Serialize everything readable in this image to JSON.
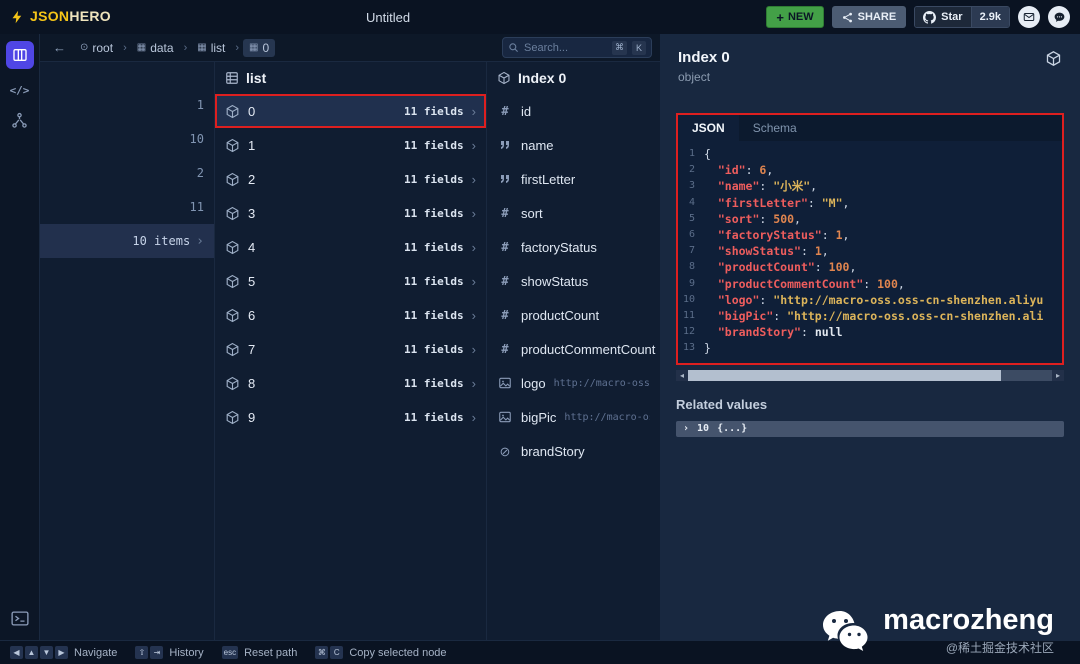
{
  "ui": {
    "chevron": "›",
    "glyphs": {
      "hash": "#",
      "null": "⊘",
      "grid": "▦",
      "root": "⊙",
      "back": "←",
      "code": "</>",
      "plus": "+"
    },
    "scrollbar_arrows": [
      "◂",
      "▸"
    ]
  },
  "topbar": {
    "logo_json": "JSON",
    "logo_hero": "HERO",
    "title": "Untitled",
    "new_button": "NEW",
    "share_button": "SHARE",
    "star_button": "Star",
    "star_count": "2.9k"
  },
  "breadcrumb": {
    "separator": "›",
    "items": [
      {
        "icon": "root-icon",
        "label": "root"
      },
      {
        "icon": "grid-icon",
        "label": "data"
      },
      {
        "icon": "grid-icon",
        "label": "list"
      },
      {
        "icon": "grid-icon",
        "label": "0",
        "selected": true
      }
    ]
  },
  "search": {
    "placeholder": "Search...",
    "shortcut_keys": [
      "⌘",
      "K"
    ]
  },
  "columns": {
    "parent": {
      "rows": [
        {
          "value": "1"
        },
        {
          "value": "10"
        },
        {
          "value": "2"
        },
        {
          "value": "11"
        },
        {
          "value": "10 items",
          "selected": true
        }
      ]
    },
    "list": {
      "title": "list",
      "rows": [
        {
          "label": "0",
          "badge": "11 fields",
          "selected": true
        },
        {
          "label": "1",
          "badge": "11 fields"
        },
        {
          "label": "2",
          "badge": "11 fields"
        },
        {
          "label": "3",
          "badge": "11 fields"
        },
        {
          "label": "4",
          "badge": "11 fields"
        },
        {
          "label": "5",
          "badge": "11 fields"
        },
        {
          "label": "6",
          "badge": "11 fields"
        },
        {
          "label": "7",
          "badge": "11 fields"
        },
        {
          "label": "8",
          "badge": "11 fields"
        },
        {
          "label": "9",
          "badge": "11 fields"
        }
      ]
    },
    "detail": {
      "title": "Index 0",
      "rows": [
        {
          "icon": "hash-icon",
          "label": "id"
        },
        {
          "icon": "quotes-icon",
          "label": "name"
        },
        {
          "icon": "quotes-icon",
          "label": "firstLetter"
        },
        {
          "icon": "hash-icon",
          "label": "sort"
        },
        {
          "icon": "hash-icon",
          "label": "factoryStatus"
        },
        {
          "icon": "hash-icon",
          "label": "showStatus"
        },
        {
          "icon": "hash-icon",
          "label": "productCount"
        },
        {
          "icon": "hash-icon",
          "label": "productCommentCount"
        },
        {
          "icon": "image-icon",
          "label": "logo",
          "preview": "http://macro-oss.o"
        },
        {
          "icon": "image-icon",
          "label": "bigPic",
          "preview": "http://macro-oss.os"
        },
        {
          "icon": "null-icon",
          "label": "brandStory"
        }
      ]
    }
  },
  "inspector": {
    "title": "Index 0",
    "subtitle": "object",
    "tabs": [
      {
        "label": "JSON",
        "active": true
      },
      {
        "label": "Schema",
        "active": false
      }
    ],
    "code_lines": [
      {
        "n": "1",
        "t": [
          [
            "p",
            "{"
          ]
        ]
      },
      {
        "n": "2",
        "t": [
          [
            "p",
            "  "
          ],
          [
            "k",
            "\"id\""
          ],
          [
            "p",
            ": "
          ],
          [
            "n",
            "6"
          ],
          [
            "p",
            ","
          ]
        ]
      },
      {
        "n": "3",
        "t": [
          [
            "p",
            "  "
          ],
          [
            "k",
            "\"name\""
          ],
          [
            "p",
            ": "
          ],
          [
            "s",
            "\"小米\""
          ],
          [
            "p",
            ","
          ]
        ]
      },
      {
        "n": "4",
        "t": [
          [
            "p",
            "  "
          ],
          [
            "k",
            "\"firstLetter\""
          ],
          [
            "p",
            ": "
          ],
          [
            "s",
            "\"M\""
          ],
          [
            "p",
            ","
          ]
        ]
      },
      {
        "n": "5",
        "t": [
          [
            "p",
            "  "
          ],
          [
            "k",
            "\"sort\""
          ],
          [
            "p",
            ": "
          ],
          [
            "n",
            "500"
          ],
          [
            "p",
            ","
          ]
        ]
      },
      {
        "n": "6",
        "t": [
          [
            "p",
            "  "
          ],
          [
            "k",
            "\"factoryStatus\""
          ],
          [
            "p",
            ": "
          ],
          [
            "n",
            "1"
          ],
          [
            "p",
            ","
          ]
        ]
      },
      {
        "n": "7",
        "t": [
          [
            "p",
            "  "
          ],
          [
            "k",
            "\"showStatus\""
          ],
          [
            "p",
            ": "
          ],
          [
            "n",
            "1"
          ],
          [
            "p",
            ","
          ]
        ]
      },
      {
        "n": "8",
        "t": [
          [
            "p",
            "  "
          ],
          [
            "k",
            "\"productCount\""
          ],
          [
            "p",
            ": "
          ],
          [
            "n",
            "100"
          ],
          [
            "p",
            ","
          ]
        ]
      },
      {
        "n": "9",
        "t": [
          [
            "p",
            "  "
          ],
          [
            "k",
            "\"productCommentCount\""
          ],
          [
            "p",
            ": "
          ],
          [
            "n",
            "100"
          ],
          [
            "p",
            ","
          ]
        ]
      },
      {
        "n": "10",
        "t": [
          [
            "p",
            "  "
          ],
          [
            "k",
            "\"logo\""
          ],
          [
            "p",
            ": "
          ],
          [
            "s",
            "\"http://macro-oss.oss-cn-shenzhen.aliyu"
          ]
        ]
      },
      {
        "n": "11",
        "t": [
          [
            "p",
            "  "
          ],
          [
            "k",
            "\"bigPic\""
          ],
          [
            "p",
            ": "
          ],
          [
            "s",
            "\"http://macro-oss.oss-cn-shenzhen.ali"
          ]
        ]
      },
      {
        "n": "12",
        "t": [
          [
            "p",
            "  "
          ],
          [
            "k",
            "\"brandStory\""
          ],
          [
            "p",
            ": "
          ],
          [
            "u",
            "null"
          ]
        ]
      },
      {
        "n": "13",
        "t": [
          [
            "p",
            "}"
          ]
        ]
      }
    ],
    "related_title": "Related values",
    "related_row": {
      "chevron": "›",
      "count": "10",
      "preview": "{...}"
    }
  },
  "statusbar": {
    "items": [
      {
        "keys": [
          "◀",
          "▲",
          "▼",
          "▶"
        ],
        "label": "Navigate"
      },
      {
        "keys": [
          "⇧",
          "⇥"
        ],
        "label": "History"
      },
      {
        "keys": [
          "esc"
        ],
        "label": "Reset path"
      },
      {
        "keys": [
          "⌘",
          "C"
        ],
        "label": "Copy selected node"
      }
    ]
  },
  "watermark": {
    "name": "macrozheng",
    "handle": "@稀土掘金技术社区"
  },
  "colors": {
    "accent": "#4f46e5",
    "annotation": "#de1f1f",
    "new_green": "#43a047",
    "logo_yellow": "#f5c518"
  }
}
